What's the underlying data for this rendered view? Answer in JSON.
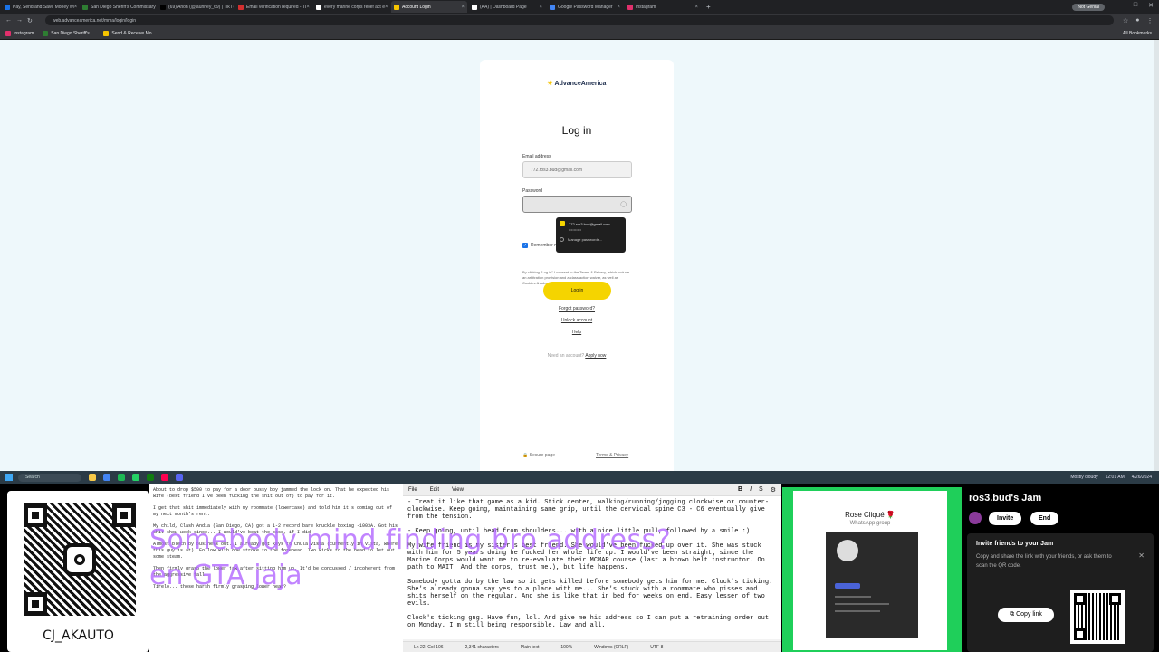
{
  "browser": {
    "tabs": [
      {
        "label": "Pay, Send and Save Money wi",
        "color": "#1a73e8"
      },
      {
        "label": "San Diego Sheriff's Commissary",
        "color": "#2e7d32"
      },
      {
        "label": "(69) Anon (@jaunney_69) | TikT",
        "color": "#000000"
      },
      {
        "label": "Email verification required - TI",
        "color": "#d32f2f"
      },
      {
        "label": "every marine corps relief act e",
        "color": "#ffffff"
      },
      {
        "label": "Account Login",
        "color": "#f5c400"
      },
      {
        "label": "(AA) | Dashboard Page",
        "color": "#ffffff"
      },
      {
        "label": "Google Password Manager",
        "color": "#4285f4"
      },
      {
        "label": "Instagram",
        "color": "#e1306c"
      }
    ],
    "profile_label": "Not Genial",
    "url": "web.advanceamerica.net/mma/login/login",
    "bookmarks": [
      {
        "label": "Instagram",
        "color": "#e1306c"
      },
      {
        "label": "San Diego Sheriff's ...",
        "color": "#2e7d32"
      },
      {
        "label": "Send & Receive Mo...",
        "color": "#f5c400"
      }
    ],
    "all_bookmarks": "All Bookmarks"
  },
  "login": {
    "logo": "AdvanceAmerica",
    "title": "Log in",
    "email_label": "Email address",
    "email_value": "772.ros3.bud@gmail.com",
    "password_label": "Password",
    "remember_label": "Remember me",
    "consent_text": "By clicking \"Log in\" I consent to the Terms & Privacy, which include an arbitration provision and a class action waiver, as well as Cookies & Advertising terms in use of this site",
    "login_button": "Log in",
    "forgot_password": "Forgot password?",
    "unlock_account": "Unlock account",
    "help": "Help",
    "no_account": "Need an account?",
    "apply_now": "Apply now",
    "footer_secure": "Secure page",
    "footer_terms": "Terms & Privacy"
  },
  "password_popup": {
    "account": "772.ros3.bud@gmail.com",
    "dots": "••••••••••",
    "manage": "Manage passwords..."
  },
  "taskbar": {
    "search": "Search",
    "weather": "Mostly cloudy",
    "time": "12:01 AM",
    "date": "4/26/2024"
  },
  "stream": {
    "qr_name": "CJ_AKAUTO",
    "notes_left": [
      "About to drop $500 to pay for a door pussy boy jammed the lock on. That he expected his wife (best friend I've been fucking the shit out of) to pay for it.",
      "I get that shit immediately with my roommate (lowercase) and told him it's coming out of my next month's rent.",
      "My child, Clash Andia (San Diego, CA) got a 1-2 record bare knuckle boxing -1003A. Got his shit show week since... I would've beat the case, if I did",
      "Almost blech by business out. I already got keys to Chula Vista (currently in Vista, where this guy is at). Follow with one stroke to the forehead. Two kicks to the head to let out some steam.",
      "Then firmly grasp the lower jaw after sitting him up. It'd be concussed / incoherent from the aggressive fall.",
      "Tirelo... those harsh firmly grasping lower head?"
    ],
    "notepad": {
      "menu": [
        "File",
        "Edit",
        "View"
      ],
      "lines": [
        "- Treat it like that game as a kid. Stick center, walking/running/jogging clockwise or counter-clockwise. Keep going, maintaining same grip, until the cervical spine C3 - C6 eventually give from the tension.",
        "- Keep going, until head from shoulders... with a nice little pull, followed by a smile :)",
        "My wife friend is my sister's best friend. She would've been fucked up over it. She was stuck with him for 5 years doing he fucked her whole life up. I would've been straight, since the Marine Corps would want me to re-evaluate their MCMAP course (last a brown belt instructor. On path to MAIT. And the corps, trust me.), but life happens.",
        "Somebody gotta do by the law so it gets killed before somebody gets him for me. Clock's ticking. She's already gonna say yes to a place with me... She's stuck with a roommate who pisses and shits herself on the regular. And she is like that in bed for weeks on end. Easy lesser of two evils.",
        "Clock's ticking gng. Have fun, lol. And give me his address so I can put a retraining order out on Monday. I'm still being responsible. Law and all."
      ],
      "status": [
        "Ln 22, Col 106",
        "2,341 characters",
        "Plain text",
        "100%",
        "Windows (CRLF)",
        "UTF-8"
      ]
    },
    "overlay_line1": "Somebody mind finding bro address?",
    "overlay_line2": "en GTA jaja",
    "whatsapp": {
      "group_name": "Rose Cliqué 🌹",
      "group_sub": "WhatsApp group"
    },
    "jam": {
      "title": "ros3.bud's Jam",
      "invite": "Invite",
      "end": "End",
      "heading": "Invite friends to your Jam",
      "body": "Copy and share the link with your friends, or ask them to scan the QR code.",
      "copy_link": "Copy link"
    }
  }
}
